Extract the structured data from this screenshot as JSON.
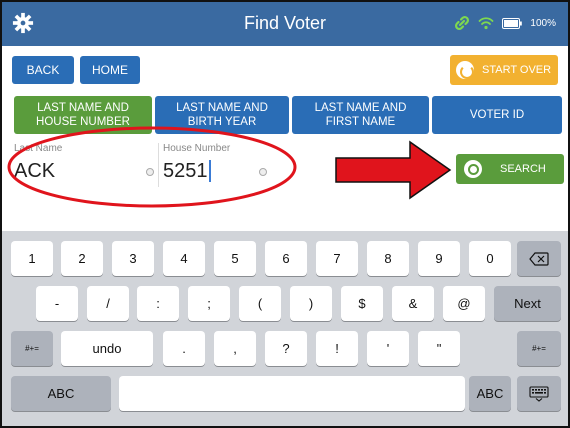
{
  "header": {
    "title": "Find Voter",
    "battery_label": "100%",
    "icons": [
      "gear-icon",
      "link-icon",
      "wifi-icon",
      "battery-icon"
    ]
  },
  "nav": {
    "back_label": "BACK",
    "home_label": "HOME",
    "start_over_label": "START OVER"
  },
  "search_modes": [
    {
      "label": "LAST NAME AND HOUSE NUMBER",
      "active": true
    },
    {
      "label": "LAST NAME AND BIRTH YEAR",
      "active": false
    },
    {
      "label": "LAST NAME AND FIRST NAME",
      "active": false
    },
    {
      "label": "VOTER ID",
      "active": false
    }
  ],
  "form": {
    "last_name_label": "Last Name",
    "last_name_value": "ACK",
    "house_number_label": "House Number",
    "house_number_value": "5251"
  },
  "search_label": "SEARCH",
  "keyboard": {
    "row1": [
      "1",
      "2",
      "3",
      "4",
      "5",
      "6",
      "7",
      "8",
      "9",
      "0"
    ],
    "backspace_icon": "backspace-icon",
    "row2": [
      "-",
      "/",
      ":",
      ";",
      "(",
      ")",
      "$",
      "&",
      "@"
    ],
    "next_label": "Next",
    "shift_label": "#+=",
    "undo_label": "undo",
    "row3": [
      ".",
      ",",
      "?",
      "!",
      "'",
      "\""
    ],
    "abc_label": "ABC",
    "dismiss_icon": "keyboard-dismiss-icon"
  },
  "colors": {
    "header": "#3a6aa1",
    "primary": "#2a6db6",
    "active": "#5a9c3c",
    "warning": "#f2b130",
    "annotation": "#e0141c"
  }
}
